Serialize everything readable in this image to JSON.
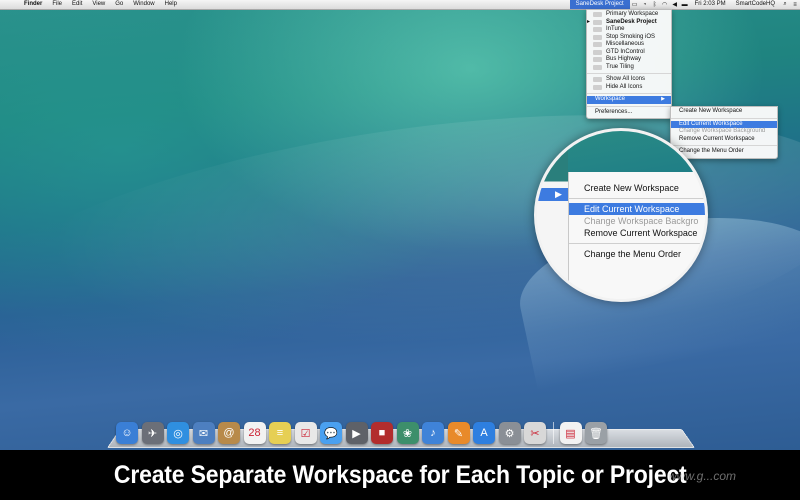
{
  "menubar": {
    "apple": "",
    "items": [
      "Finder",
      "File",
      "Edit",
      "View",
      "Go",
      "Window",
      "Help"
    ],
    "status": {
      "app_menu": "SaneDesk Project",
      "clock": "Fri 2:03 PM",
      "user": "SmartCodeHQ"
    }
  },
  "main_menu": {
    "workspaces": [
      {
        "label": "Primary Workspace",
        "checked": false,
        "bold": false
      },
      {
        "label": "SaneDesk Project",
        "checked": true,
        "bold": true
      },
      {
        "label": "InTune",
        "checked": false,
        "bold": false
      },
      {
        "label": "Stop Smoking iOS",
        "checked": false,
        "bold": false
      },
      {
        "label": "Miscellaneous",
        "checked": false,
        "bold": false
      },
      {
        "label": "GTD InControl",
        "checked": false,
        "bold": false
      },
      {
        "label": "Bus Highway",
        "checked": false,
        "bold": false
      },
      {
        "label": "True Tiling",
        "checked": false,
        "bold": false
      }
    ],
    "icon_actions": [
      "Show All Icons",
      "Hide All Icons"
    ],
    "workspace_label": "Workspace",
    "preferences_label": "Preferences..."
  },
  "sub_menu": {
    "items": [
      {
        "label": "Create New Workspace",
        "state": "normal"
      },
      {
        "label": "Edit Current Workspace",
        "state": "highlighted"
      },
      {
        "label": "Change Workspace Background",
        "state": "disabled"
      },
      {
        "label": "Remove Current Workspace",
        "state": "normal"
      }
    ],
    "order_label": "Change the Menu Order"
  },
  "magnifier": {
    "items": [
      {
        "label": "Create New Workspace",
        "state": "normal"
      },
      {
        "label": "Edit Current Workspace",
        "state": "highlighted"
      },
      {
        "label": "Change Workspace Backgro",
        "state": "disabled"
      },
      {
        "label": "Remove Current Workspace",
        "state": "normal"
      }
    ],
    "order_label": "Change the Menu Order"
  },
  "dock": {
    "apps": [
      {
        "name": "finder-icon",
        "glyph": "☺",
        "color": "#3a7fd6"
      },
      {
        "name": "launchpad-icon",
        "glyph": "✈",
        "color": "#6b6f78"
      },
      {
        "name": "safari-icon",
        "glyph": "◎",
        "color": "#2f8fe0"
      },
      {
        "name": "mail-icon",
        "glyph": "✉",
        "color": "#4d7fc0"
      },
      {
        "name": "contacts-icon",
        "glyph": "@",
        "color": "#b88a4a"
      },
      {
        "name": "calendar-icon",
        "glyph": "28",
        "color": "#f2f2f2"
      },
      {
        "name": "notes-icon",
        "glyph": "≡",
        "color": "#e6cf54"
      },
      {
        "name": "reminders-icon",
        "glyph": "☑",
        "color": "#e8e8e8"
      },
      {
        "name": "messages-icon",
        "glyph": "💬",
        "color": "#4aa0f0"
      },
      {
        "name": "facetime-icon",
        "glyph": "▶",
        "color": "#5e6168"
      },
      {
        "name": "photo-booth-icon",
        "glyph": "■",
        "color": "#b22d2d"
      },
      {
        "name": "iphoto-icon",
        "glyph": "❀",
        "color": "#3d8f6b"
      },
      {
        "name": "itunes-icon",
        "glyph": "♪",
        "color": "#3f83d8"
      },
      {
        "name": "ibooks-icon",
        "glyph": "✎",
        "color": "#e88a2a"
      },
      {
        "name": "app-store-icon",
        "glyph": "A",
        "color": "#2e7fe0"
      },
      {
        "name": "system-preferences-icon",
        "glyph": "⚙",
        "color": "#8a8f96"
      },
      {
        "name": "preview-icon",
        "glyph": "✂",
        "color": "#d8d8d8"
      }
    ],
    "trailing": [
      {
        "name": "document-icon",
        "glyph": "▤",
        "color": "#f2f2f2"
      },
      {
        "name": "trash-icon",
        "glyph": "🗑",
        "color": "#9aa0a6"
      }
    ]
  },
  "caption": {
    "text": "Create Separate Workspace for Each Topic or Project"
  },
  "watermark": "www.g...com"
}
